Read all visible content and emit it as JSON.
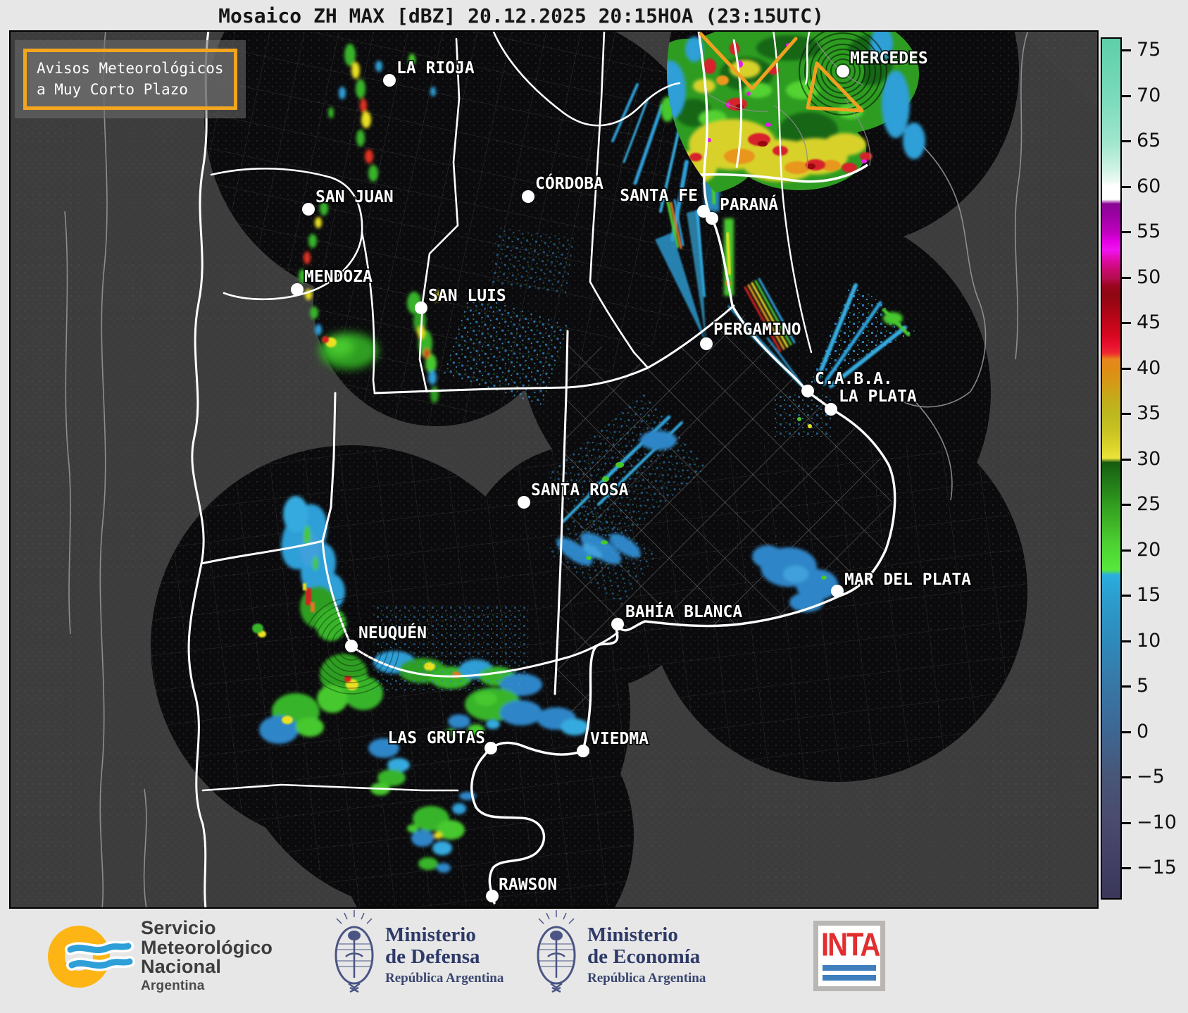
{
  "title": "Mosaico ZH MAX [dBZ] 20.12.2025 20:15HOA (23:15UTC)",
  "warning_box": {
    "line1": "Avisos Meteorológicos",
    "line2": "a Muy Corto Plazo",
    "border_color": "#f2a51e"
  },
  "colorbar": {
    "ticks": [
      "75",
      "70",
      "65",
      "60",
      "55",
      "50",
      "45",
      "40",
      "35",
      "30",
      "25",
      "20",
      "15",
      "10",
      "5",
      "0",
      "−5",
      "−10",
      "−15"
    ],
    "scale_colors": [
      {
        "dbz": 75,
        "color": "#5ecfa8"
      },
      {
        "dbz": 60,
        "color": "#ffffff"
      },
      {
        "dbz": 55,
        "color": "#c100c1"
      },
      {
        "dbz": 50,
        "color": "#b30c4e"
      },
      {
        "dbz": 45,
        "color": "#c10619"
      },
      {
        "dbz": 40,
        "color": "#d49a17"
      },
      {
        "dbz": 35,
        "color": "#c7c01f"
      },
      {
        "dbz": 30,
        "color": "#ece43a"
      },
      {
        "dbz": 25,
        "color": "#339e1f"
      },
      {
        "dbz": 20,
        "color": "#4cd031"
      },
      {
        "dbz": 15,
        "color": "#2b9fcf"
      },
      {
        "dbz": 10,
        "color": "#2e8abb"
      },
      {
        "dbz": 5,
        "color": "#3877a6"
      },
      {
        "dbz": 0,
        "color": "#3e6693"
      },
      {
        "dbz": -5,
        "color": "#475677"
      },
      {
        "dbz": -10,
        "color": "#4a4a6e"
      },
      {
        "dbz": -15,
        "color": "#403e63"
      }
    ]
  },
  "map": {
    "cities": [
      {
        "name": "LA RIOJA"
      },
      {
        "name": "SAN JUAN"
      },
      {
        "name": "CÓRDOBA"
      },
      {
        "name": "MENDOZA"
      },
      {
        "name": "SAN LUIS"
      },
      {
        "name": "SANTA FE"
      },
      {
        "name": "PARANÁ"
      },
      {
        "name": "MERCEDES"
      },
      {
        "name": "PERGAMINO"
      },
      {
        "name": "C.A.B.A."
      },
      {
        "name": "LA PLATA"
      },
      {
        "name": "SANTA ROSA"
      },
      {
        "name": "NEUQUÉN"
      },
      {
        "name": "LAS GRUTAS"
      },
      {
        "name": "VIEDMA"
      },
      {
        "name": "BAHÍA BLANCA"
      },
      {
        "name": "MAR DEL PLATA"
      },
      {
        "name": "RAWSON"
      }
    ]
  },
  "footer": {
    "smn": {
      "line1": "Servicio",
      "line2": "Meteorológico",
      "line3": "Nacional",
      "country": "Argentina"
    },
    "defensa": {
      "line1": "Ministerio",
      "line2": "de Defensa",
      "sub": "República Argentina"
    },
    "economia": {
      "line1": "Ministerio",
      "line2": "de Economía",
      "sub": "República Argentina"
    },
    "inta": {
      "label": "INTA"
    }
  }
}
